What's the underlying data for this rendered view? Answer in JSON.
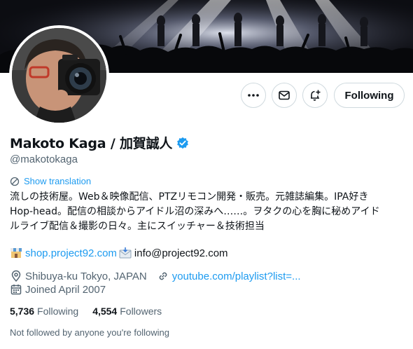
{
  "profile": {
    "display_name": "Makoto Kaga / 加賀誠人",
    "handle": "@makotokaga",
    "verified_icon": "verified-badge-icon"
  },
  "actions": {
    "more_icon": "more-icon",
    "message_icon": "envelope-icon",
    "notify_icon": "bell-plus-icon",
    "following_label": "Following"
  },
  "translate": {
    "label": "Show translation",
    "icon": "translate-icon"
  },
  "bio": {
    "lines": [
      "流しの技術屋。Web＆映像配信、PTZリモコン開発・販売。元雑誌編集。IPA好き",
      "Hop-head。配信の相談からアイドル沼の深みへ……。ヲタクの心を胸に秘めアイド",
      "ルライブ配信＆撮影の日々。主にスイッチャー＆技術担当"
    ],
    "shop_link": "shop.project92.com",
    "email": "info@project92.com"
  },
  "meta": {
    "location": "Shibuya-ku Tokyo, JAPAN",
    "website": "youtube.com/playlist?list=...",
    "joined": "Joined April 2007"
  },
  "stats": {
    "following_count": "5,736",
    "following_label": "Following",
    "followers_count": "4,554",
    "followers_label": "Followers"
  },
  "not_followed_text": "Not followed by anyone you're following",
  "colors": {
    "accent": "#1d9bf0",
    "secondary_text": "#536471",
    "border": "#cfd9de"
  }
}
